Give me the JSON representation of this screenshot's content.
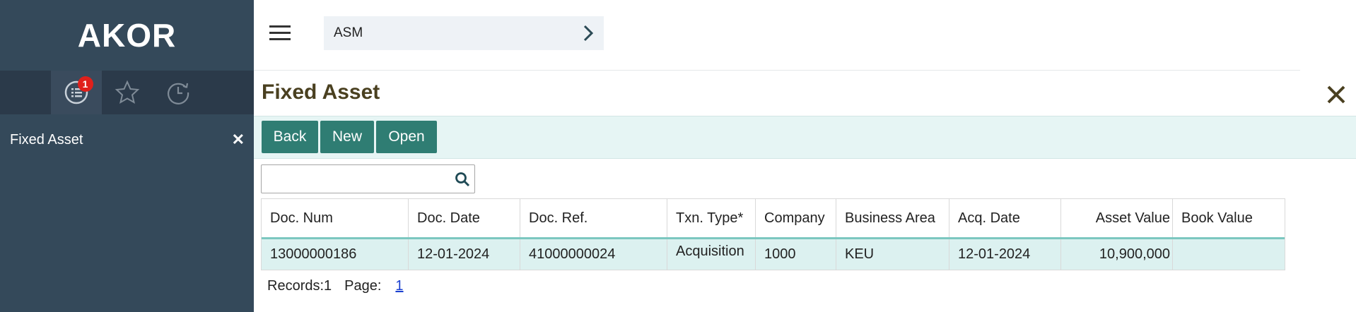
{
  "app": {
    "brand": "AKOR"
  },
  "sidebar": {
    "tabs": [
      {
        "name": "list-icon",
        "badge": "1",
        "active": true
      },
      {
        "name": "star-icon"
      },
      {
        "name": "history-icon"
      }
    ],
    "item": {
      "label": "Fixed Asset",
      "close": "✕"
    }
  },
  "topbar": {
    "breadcrumb": "ASM"
  },
  "page": {
    "title": "Fixed Asset"
  },
  "toolbar": {
    "back_label": "Back",
    "new_label": "New",
    "open_label": "Open"
  },
  "search": {
    "value": "",
    "placeholder": ""
  },
  "table": {
    "columns": [
      "Doc. Num",
      "Doc. Date",
      "Doc. Ref.",
      "Txn. Type*",
      "Company",
      "Business Area",
      "Acq. Date",
      "Asset Value",
      "Book Value"
    ],
    "rows": [
      [
        "13000000186",
        "12-01-2024",
        "41000000024",
        "Acquisition",
        "1000",
        "KEU",
        "12-01-2024",
        "10,900,000",
        ""
      ]
    ]
  },
  "footer": {
    "records_label": "Records:1",
    "page_label": "Page:",
    "page_link": "1"
  },
  "colors": {
    "sidebar": "#34495a",
    "accent": "#2f7d73",
    "toolbar_bg": "#e6f5f4",
    "row_bg": "#dcf1f0",
    "title": "#4a4020"
  }
}
